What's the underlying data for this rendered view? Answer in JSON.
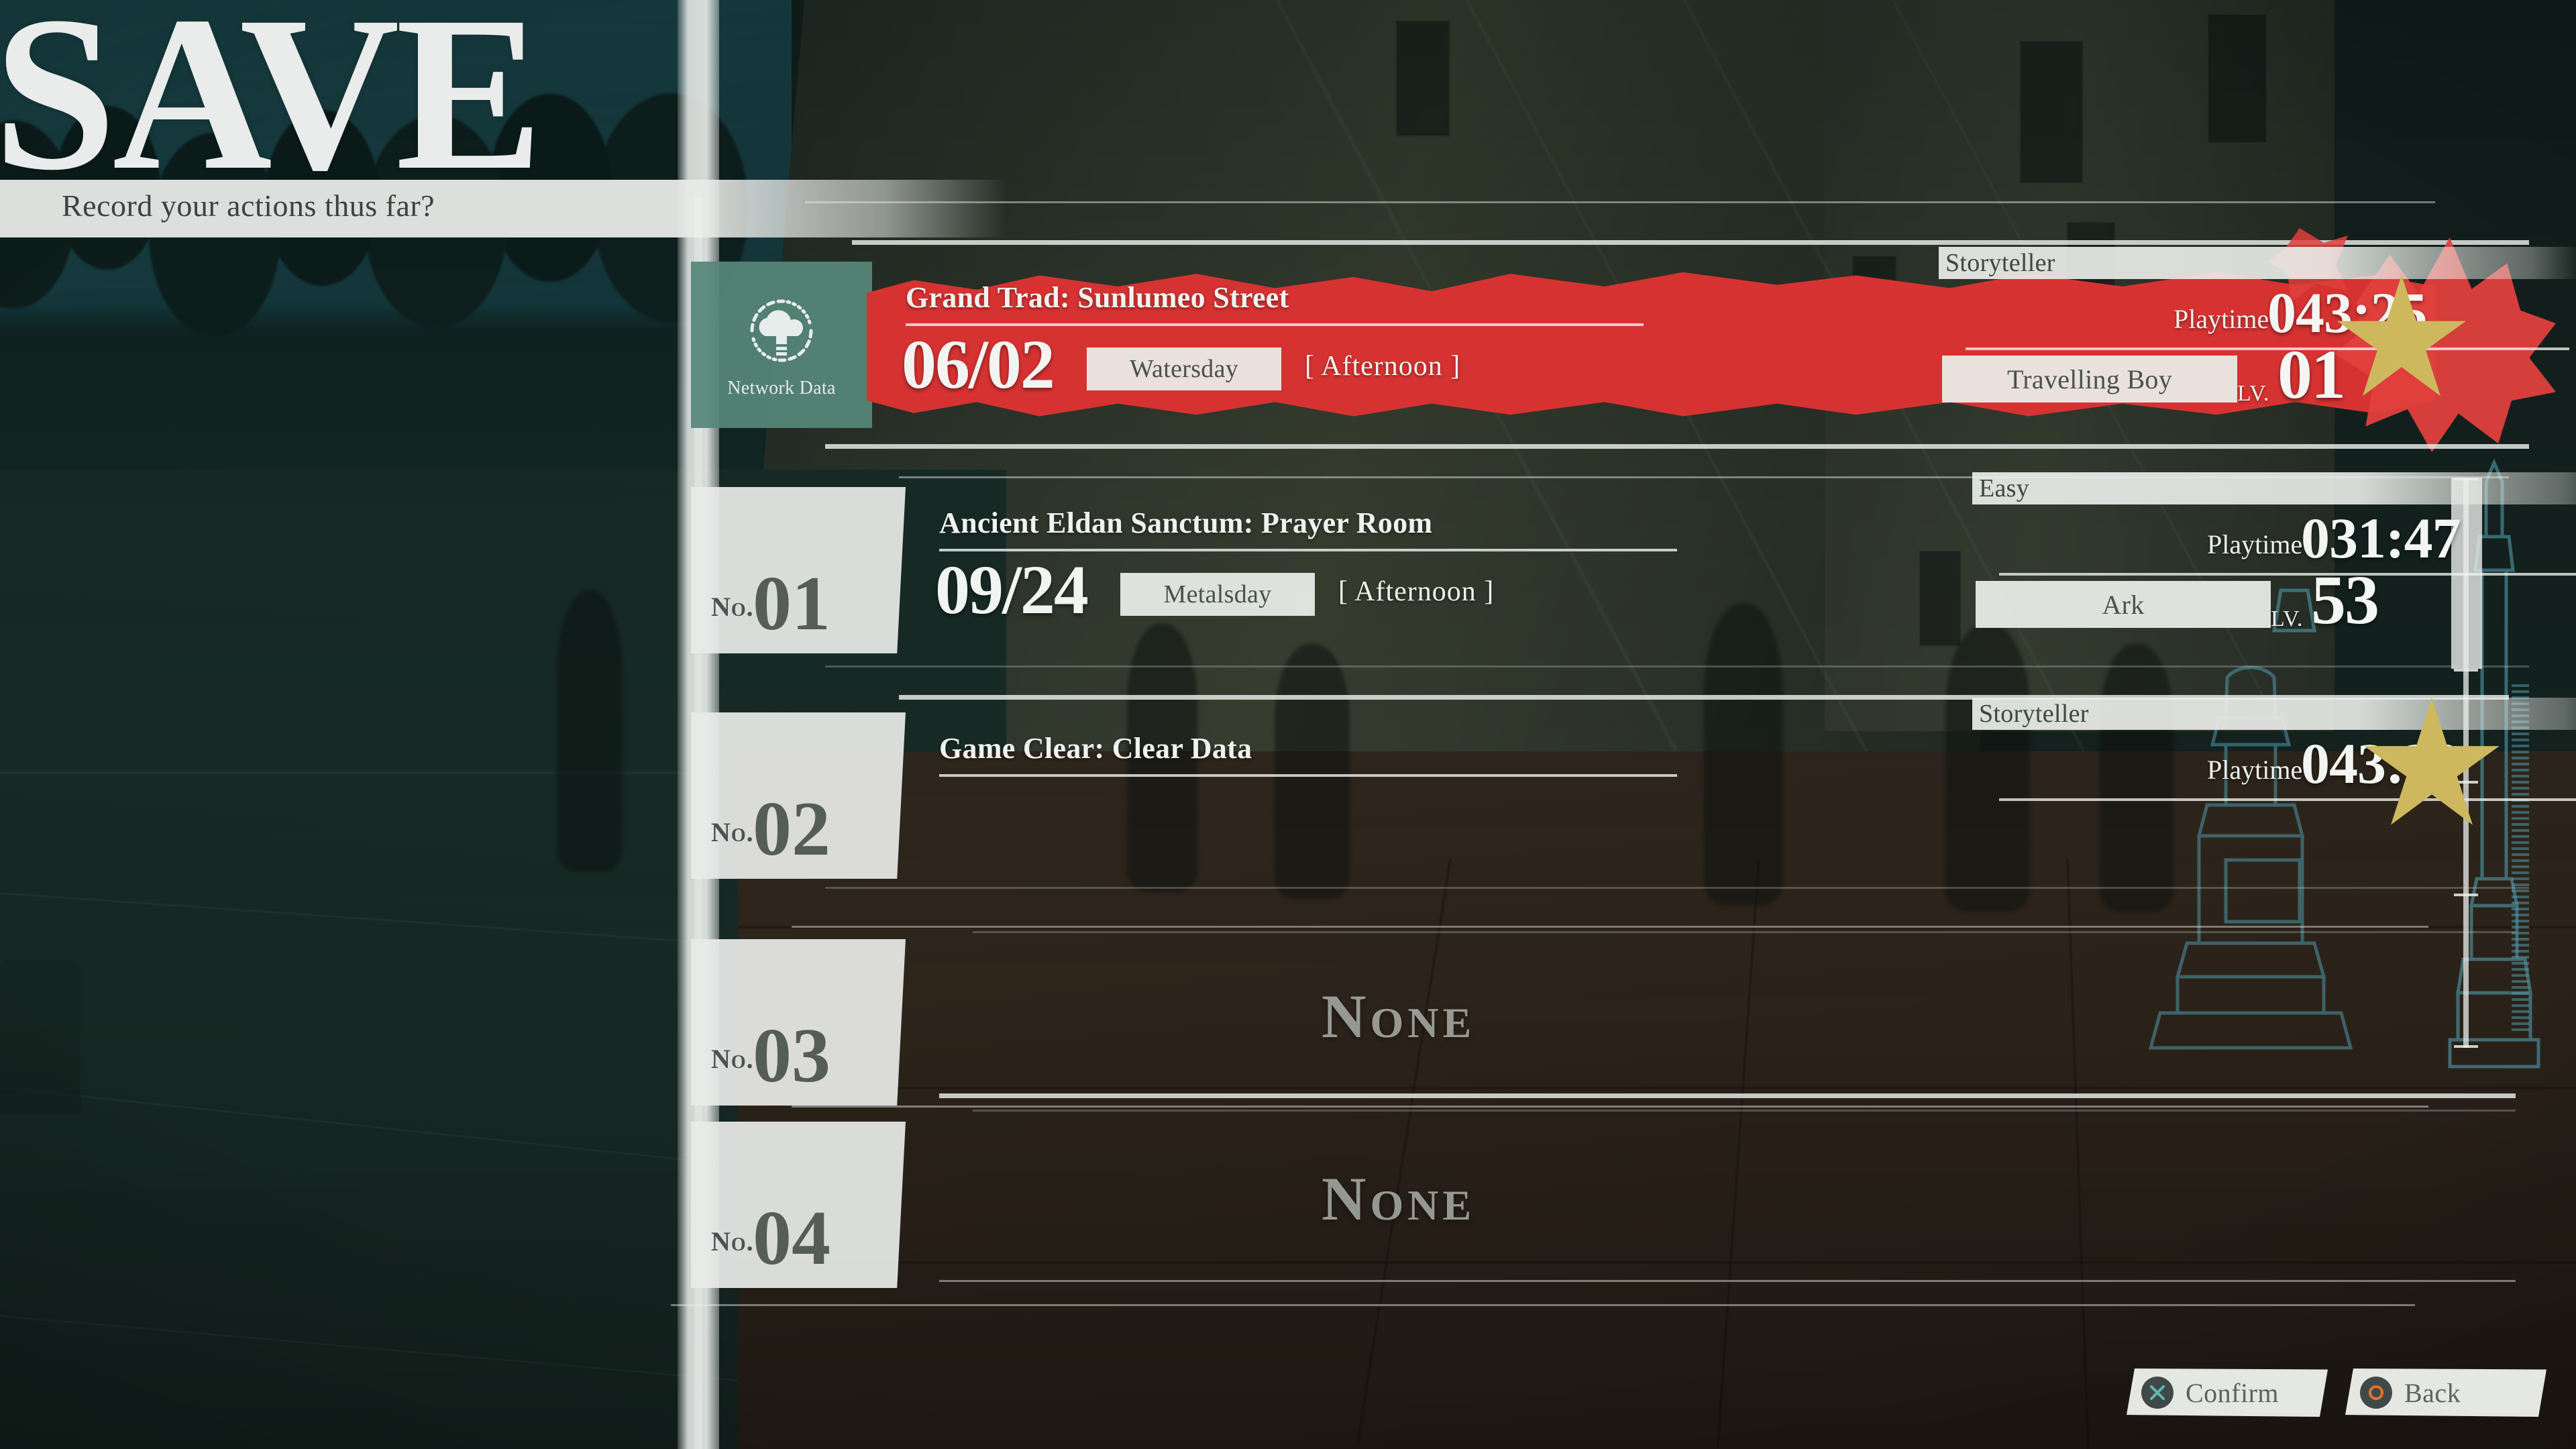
{
  "header": {
    "title": "SAVE",
    "subtitle": "Record your actions thus far?"
  },
  "network_slot": {
    "icon": "cloud-upload-icon",
    "label": "Network Data"
  },
  "labels": {
    "playtime": "Playtime",
    "level_prefix": "LV.",
    "no_prefix": "No.",
    "empty": "None"
  },
  "colors": {
    "selected_red": "#d63232",
    "network_green": "#56867a",
    "star_gold": "#cdb85e",
    "panel_white": "#ecefec",
    "confirm_glyph": "#5fb8b4",
    "back_glyph": "#e8712c"
  },
  "slots": [
    {
      "selected": true,
      "is_network": true,
      "number_label": "",
      "number": "",
      "location": "Grand Trad: Sunlumeo Street",
      "date": "06/02",
      "day": "Watersday",
      "time_of_day": "[ Afternoon ]",
      "difficulty": "Storyteller",
      "playtime": "043:25",
      "character": "Travelling Boy",
      "level": "01",
      "has_star": true,
      "empty": false
    },
    {
      "selected": false,
      "is_network": false,
      "number_label": "No.",
      "number": "01",
      "location": "Ancient Eldan Sanctum: Prayer Room",
      "date": "09/24",
      "day": "Metalsday",
      "time_of_day": "[ Afternoon ]",
      "difficulty": "Easy",
      "playtime": "031:47",
      "character": "Ark",
      "level": "53",
      "has_star": false,
      "empty": false
    },
    {
      "selected": false,
      "is_network": false,
      "number_label": "No.",
      "number": "02",
      "location": "Game Clear: Clear Data",
      "date": "",
      "day": "",
      "time_of_day": "",
      "difficulty": "Storyteller",
      "playtime": "043:20",
      "character": "",
      "level": "",
      "has_star": true,
      "empty": false
    },
    {
      "selected": false,
      "is_network": false,
      "number_label": "No.",
      "number": "03",
      "location": "",
      "date": "",
      "day": "",
      "time_of_day": "",
      "difficulty": "",
      "playtime": "",
      "character": "",
      "level": "",
      "has_star": false,
      "empty": true,
      "empty_text": "None"
    },
    {
      "selected": false,
      "is_network": false,
      "number_label": "No.",
      "number": "04",
      "location": "",
      "date": "",
      "day": "",
      "time_of_day": "",
      "difficulty": "",
      "playtime": "",
      "character": "",
      "level": "",
      "has_star": false,
      "empty": true,
      "empty_text": "None"
    }
  ],
  "prompts": [
    {
      "glyph": "cross-button-icon",
      "label": "Confirm"
    },
    {
      "glyph": "circle-button-icon",
      "label": "Back"
    }
  ]
}
